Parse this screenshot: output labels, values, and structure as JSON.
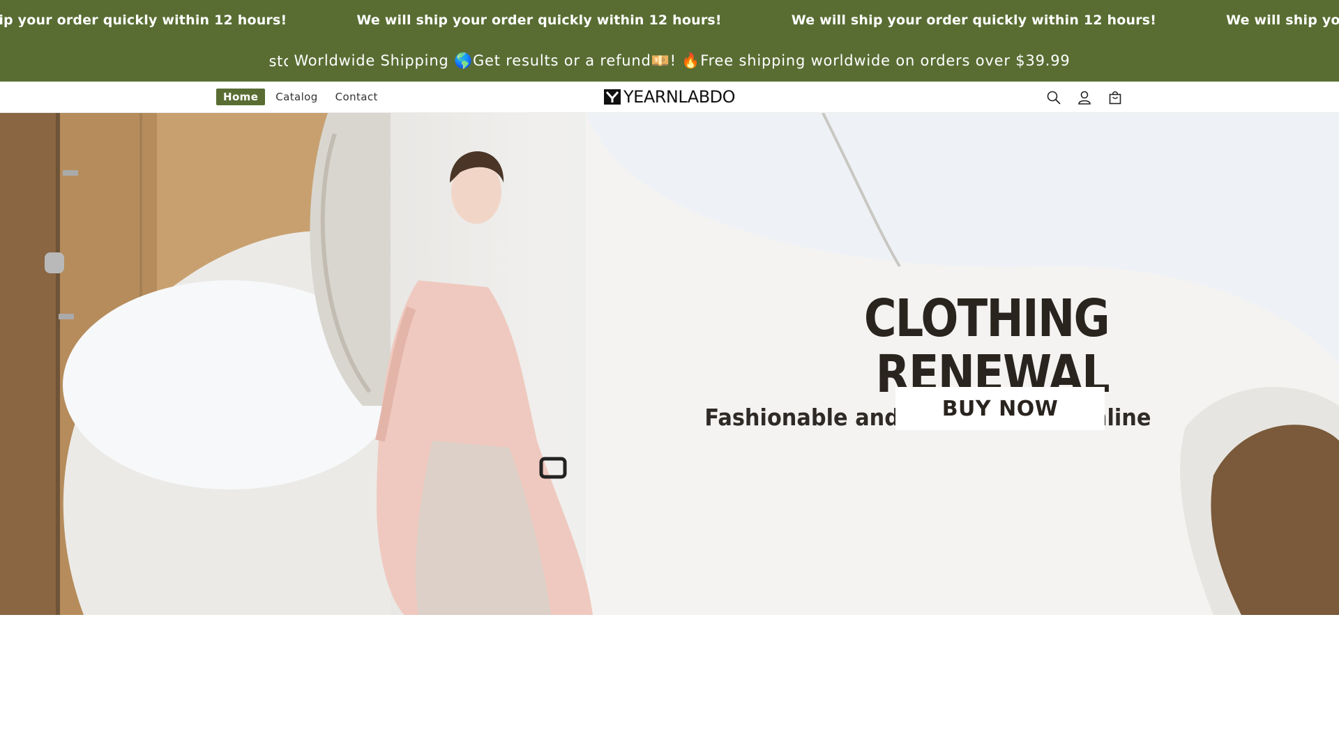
{
  "announcement": {
    "marquee_text": "We will ship your order quickly within 12 hours!",
    "promo_prefix": "stc",
    "promo_text": "Worldwide Shipping 🌎Get results or a refund💴! 🔥Free shipping worldwide on orders over $39.99"
  },
  "header": {
    "nav": [
      {
        "label": "Home",
        "active": true
      },
      {
        "label": "Catalog",
        "active": false
      },
      {
        "label": "Contact",
        "active": false
      }
    ],
    "logo_text": "YEARNLABDO",
    "icons": [
      "search-icon",
      "account-icon",
      "cart-icon"
    ]
  },
  "hero": {
    "title": "CLOTHING RENEWAL",
    "subtitle": "Fashionable and practical dual online",
    "button_label": "BUY NOW"
  },
  "colors": {
    "brand_green": "#596d33",
    "text_dark": "#2a241f"
  }
}
